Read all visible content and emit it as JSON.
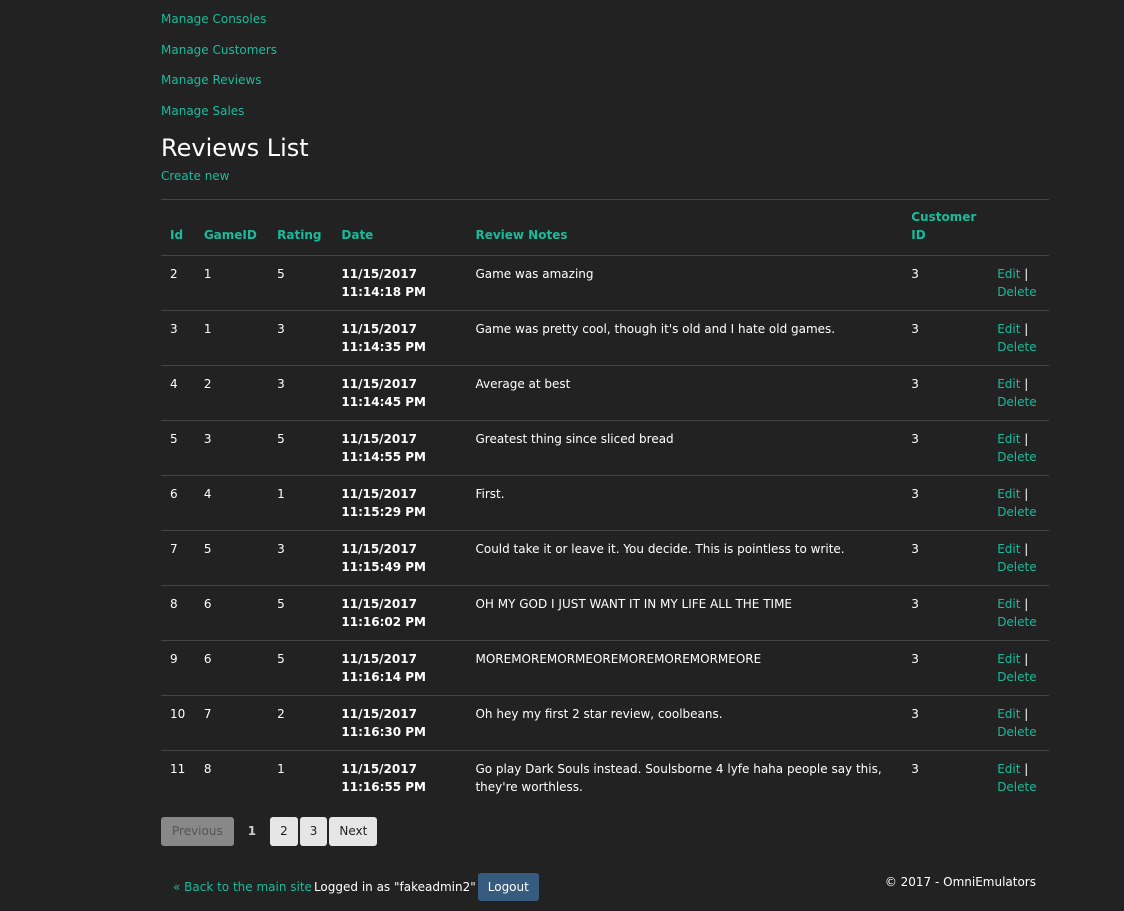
{
  "nav": {
    "manage_consoles": "Manage Consoles",
    "manage_customers": "Manage Customers",
    "manage_reviews": "Manage Reviews",
    "manage_sales": "Manage Sales"
  },
  "page": {
    "title": "Reviews List",
    "create_new": "Create new"
  },
  "table": {
    "headers": {
      "id": "Id",
      "game_id": "GameID",
      "rating": "Rating",
      "date": "Date",
      "review_notes": "Review Notes",
      "customer_id": "Customer ID"
    },
    "edit_label": "Edit",
    "separator": "|",
    "delete_label": "Delete",
    "rows": [
      {
        "id": "2",
        "game_id": "1",
        "rating": "5",
        "date": "11/15/2017 11:14:18 PM",
        "notes": "Game was amazing",
        "customer_id": "3"
      },
      {
        "id": "3",
        "game_id": "1",
        "rating": "3",
        "date": "11/15/2017 11:14:35 PM",
        "notes": "Game was pretty cool, though it's old and I hate old games.",
        "customer_id": "3"
      },
      {
        "id": "4",
        "game_id": "2",
        "rating": "3",
        "date": "11/15/2017 11:14:45 PM",
        "notes": "Average at best",
        "customer_id": "3"
      },
      {
        "id": "5",
        "game_id": "3",
        "rating": "5",
        "date": "11/15/2017 11:14:55 PM",
        "notes": "Greatest thing since sliced bread",
        "customer_id": "3"
      },
      {
        "id": "6",
        "game_id": "4",
        "rating": "1",
        "date": "11/15/2017 11:15:29 PM",
        "notes": "First.",
        "customer_id": "3"
      },
      {
        "id": "7",
        "game_id": "5",
        "rating": "3",
        "date": "11/15/2017 11:15:49 PM",
        "notes": "Could take it or leave it. You decide. This is pointless to write.",
        "customer_id": "3"
      },
      {
        "id": "8",
        "game_id": "6",
        "rating": "5",
        "date": "11/15/2017 11:16:02 PM",
        "notes": "OH MY GOD I JUST WANT IT IN MY LIFE ALL THE TIME",
        "customer_id": "3"
      },
      {
        "id": "9",
        "game_id": "6",
        "rating": "5",
        "date": "11/15/2017 11:16:14 PM",
        "notes": "MOREMOREMORMEOREMOREMOREMORMEORE",
        "customer_id": "3"
      },
      {
        "id": "10",
        "game_id": "7",
        "rating": "2",
        "date": "11/15/2017 11:16:30 PM",
        "notes": "Oh hey my first 2 star review, coolbeans.",
        "customer_id": "3"
      },
      {
        "id": "11",
        "game_id": "8",
        "rating": "1",
        "date": "11/15/2017 11:16:55 PM",
        "notes": "Go play Dark Souls instead. Soulsborne 4 lyfe haha people say this, they're worthless.",
        "customer_id": "3"
      }
    ]
  },
  "pagination": {
    "previous": "Previous",
    "pages": [
      "1",
      "2",
      "3"
    ],
    "current": "1",
    "next": "Next"
  },
  "footer": {
    "back_link": "« Back to the main site",
    "logged_in": "Logged in as \"fakeadmin2\"",
    "logout": "Logout",
    "copyright": "© 2017 - OmniEmulators"
  },
  "colors": {
    "background": "#222222",
    "link": "#18bc9c",
    "logout_button": "#375a7f",
    "row_border": "#464545"
  }
}
